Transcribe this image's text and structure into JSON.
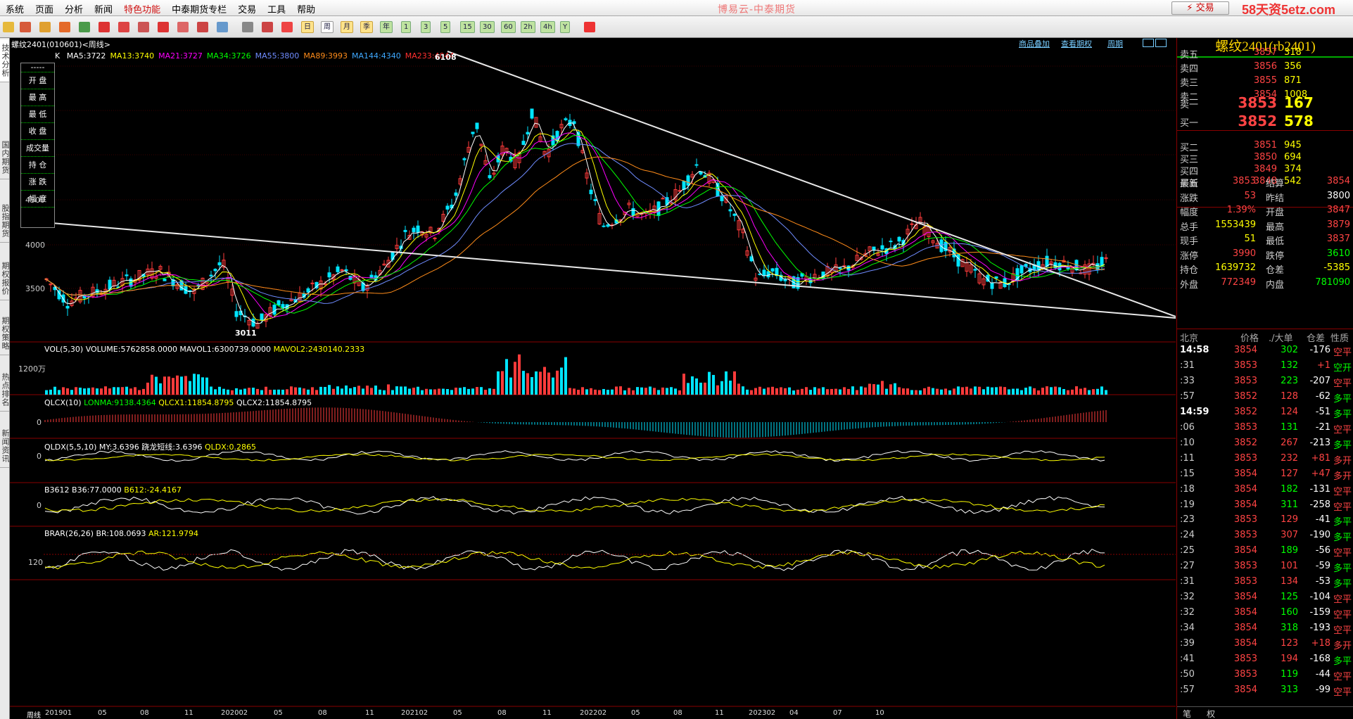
{
  "menu": {
    "items": [
      "系统",
      "页面",
      "分析",
      "新闻",
      "特色功能",
      "中泰期货专栏",
      "交易",
      "工具",
      "帮助"
    ],
    "app_title": "博易云-中泰期货",
    "trade_button": "交易",
    "site_logo": "58天资5etz.com"
  },
  "toolbar": {
    "periods": [
      "日",
      "周",
      "月",
      "季",
      "年",
      "1",
      "3",
      "5",
      "15",
      "30",
      "60",
      "2h",
      "4h",
      "Y"
    ]
  },
  "left_tabs": [
    "技术分析",
    "国内期货",
    "股指期货",
    "期权报价",
    "期权策略",
    "热点排名",
    "新闻资讯"
  ],
  "chart": {
    "title": "螺纹2401(010601)<周线>",
    "links": [
      "商品叠加",
      "查看期权",
      "周期"
    ],
    "k_label": "K",
    "ma_legend": [
      {
        "text": "MA5:3722",
        "color": "#ffffff"
      },
      {
        "text": "MA13:3740",
        "color": "#ffff00"
      },
      {
        "text": "MA21:3727",
        "color": "#ff00ff"
      },
      {
        "text": "MA34:3726",
        "color": "#00ff00"
      },
      {
        "text": "MA55:3800",
        "color": "#6f8cff"
      },
      {
        "text": "MA89:3993",
        "color": "#ff8c1a"
      },
      {
        "text": "MA144:4340",
        "color": "#3fa9ff"
      },
      {
        "text": "MA233:4044",
        "color": "#ff3030"
      }
    ],
    "ohlc_box": [
      "开 盘",
      "最 高",
      "最 低",
      "收 盘",
      "成交量",
      "持 仓",
      "涨 跌",
      "幅 度"
    ],
    "price_axis": [
      "4500",
      "4000",
      "3500"
    ],
    "annot_high": "6108",
    "annot_low": "3011",
    "vol_legend": [
      {
        "text": "VOL(5,30) VOLUME:5762858.0000 MAVOL1:6300739.0000",
        "color": "#ffffff"
      },
      {
        "text": "MAVOL2:2430140.2333",
        "color": "#ffff00"
      }
    ],
    "vol_axis": "1200万",
    "qlcx_legend": [
      {
        "text": "QLCX(10)",
        "color": "#ffffff"
      },
      {
        "text": "LONMA:9138.4364",
        "color": "#00ff00"
      },
      {
        "text": "QLCX1:11854.8795",
        "color": "#ffff00"
      },
      {
        "text": "QLCX2:11854.8795",
        "color": "#ffffff"
      }
    ],
    "qldx_legend": [
      {
        "text": "QLDX(5,5,10) MY:3.6396 跷龙短线:3.6396",
        "color": "#ffffff"
      },
      {
        "text": "QLDX:0.2865",
        "color": "#ffff00"
      }
    ],
    "b3612_legend": [
      {
        "text": "B3612 B36:77.0000",
        "color": "#ffffff"
      },
      {
        "text": "B612:-24.4167",
        "color": "#ffff00"
      }
    ],
    "brar_legend": [
      {
        "text": "BRAR(26,26) BR:108.0693",
        "color": "#ffffff"
      },
      {
        "text": "AR:121.9794",
        "color": "#ffff00"
      }
    ],
    "zero": "0",
    "brar_axis": "120",
    "x_axis_label": "周线",
    "x_axis": [
      "201901",
      "05",
      "08",
      "11",
      "202002",
      "05",
      "08",
      "11",
      "202102",
      "05",
      "08",
      "11",
      "202202",
      "05",
      "08",
      "11",
      "202302",
      "04",
      "07",
      "10"
    ]
  },
  "quote": {
    "name": "螺纹2401(rb2401)",
    "asks": [
      {
        "label": "卖五",
        "price": "3857",
        "vol": "318"
      },
      {
        "label": "卖四",
        "price": "3856",
        "vol": "356"
      },
      {
        "label": "卖三",
        "price": "3855",
        "vol": "871"
      },
      {
        "label": "卖二",
        "price": "3854",
        "vol": "1008"
      },
      {
        "label": "卖一",
        "price": "3853",
        "vol": "167"
      }
    ],
    "bids": [
      {
        "label": "买一",
        "price": "3852",
        "vol": "578"
      },
      {
        "label": "买二",
        "price": "3851",
        "vol": "945"
      },
      {
        "label": "买三",
        "price": "3850",
        "vol": "694"
      },
      {
        "label": "买四",
        "price": "3849",
        "vol": "374"
      },
      {
        "label": "买五",
        "price": "3848",
        "vol": "542"
      }
    ],
    "stats": [
      [
        "最新",
        "3853",
        "结算",
        "3854"
      ],
      [
        "涨跌",
        "53",
        "昨结",
        "3800"
      ],
      [
        "幅度",
        "1.39%",
        "开盘",
        "3847"
      ],
      [
        "总手",
        "1553439",
        "最高",
        "3879"
      ],
      [
        "现手",
        "51",
        "最低",
        "3837"
      ],
      [
        "涨停",
        "3990",
        "跌停",
        "3610"
      ],
      [
        "持仓",
        "1639732",
        "仓差",
        "-5385"
      ],
      [
        "外盘",
        "772349",
        "内盘",
        "781090"
      ]
    ],
    "ticks_header": [
      "北京",
      "价格",
      "./大单",
      "仓差",
      "性质"
    ],
    "ticks": [
      [
        "14:58",
        "3854",
        "302",
        "-176",
        "空平"
      ],
      [
        ":31",
        "3853",
        "132",
        "+1",
        "空开"
      ],
      [
        ":33",
        "3853",
        "223",
        "-207",
        "空平"
      ],
      [
        ":57",
        "3852",
        "128",
        "-62",
        "多平"
      ],
      [
        "14:59",
        "3852",
        "124",
        "-51",
        "多平"
      ],
      [
        ":06",
        "3853",
        "131",
        "-21",
        "空平"
      ],
      [
        ":10",
        "3852",
        "267",
        "-213",
        "多平"
      ],
      [
        ":11",
        "3853",
        "232",
        "+81",
        "多开"
      ],
      [
        ":15",
        "3854",
        "127",
        "+47",
        "多开"
      ],
      [
        ":18",
        "3854",
        "182",
        "-131",
        "空平"
      ],
      [
        ":19",
        "3854",
        "311",
        "-258",
        "空平"
      ],
      [
        ":23",
        "3853",
        "129",
        "-41",
        "多平"
      ],
      [
        ":24",
        "3853",
        "307",
        "-190",
        "多平"
      ],
      [
        ":25",
        "3854",
        "189",
        "-56",
        "空平"
      ],
      [
        ":27",
        "3853",
        "101",
        "-59",
        "多平"
      ],
      [
        ":31",
        "3853",
        "134",
        "-53",
        "多平"
      ],
      [
        ":32",
        "3854",
        "125",
        "-104",
        "空平"
      ],
      [
        ":32",
        "3854",
        "160",
        "-159",
        "空平"
      ],
      [
        ":34",
        "3854",
        "318",
        "-193",
        "空平"
      ],
      [
        ":39",
        "3854",
        "123",
        "+18",
        "多开"
      ],
      [
        ":41",
        "3853",
        "194",
        "-168",
        "多平"
      ],
      [
        ":50",
        "3853",
        "119",
        "-44",
        "空平"
      ],
      [
        ":57",
        "3854",
        "313",
        "-99",
        "空平"
      ]
    ],
    "bottom_tabs": [
      "笔",
      "权"
    ]
  }
}
